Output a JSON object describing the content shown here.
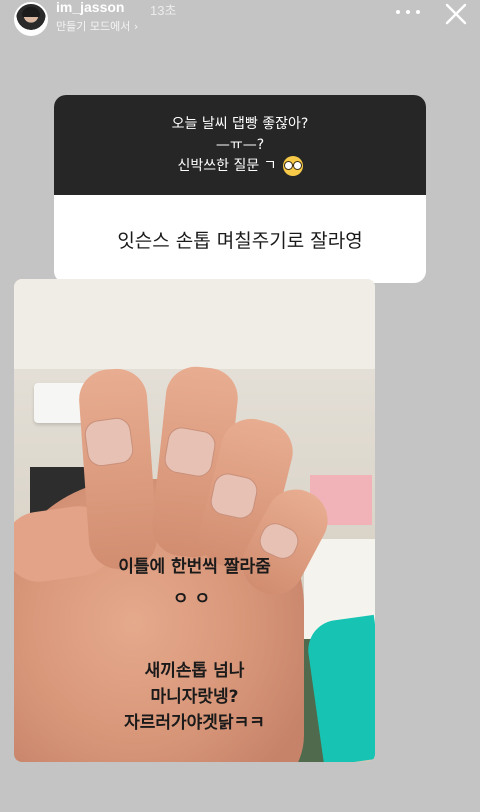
{
  "header": {
    "username": "im_jasson",
    "time": "13초",
    "subtitle": "만들기 모드에서",
    "subtitle_chevron": "›",
    "more_icon": "more-horizontal-icon",
    "close_icon": "close-icon"
  },
  "question": {
    "line1": "오늘 날씨 댑빵 좋잖아?",
    "line2": "—ㅠ—?",
    "line3": "신박쓰한 질문 ㄱ",
    "emoji": "nerd-face-emoji",
    "answer": "잇슨스 손톱 며칠주기로 잘라영"
  },
  "photo": {
    "caption_line1": "이틀에 한번씩 짤라줌",
    "caption_line2": "ㅇㅇ",
    "caption_line3": "새끼손톱 넘나",
    "caption_line4": "마니자랏넹?",
    "caption_line5": "자르러가야겟닭ㅋㅋ"
  },
  "colors": {
    "background": "#c4c4c4",
    "question_header_bg": "#262626",
    "answer_bg": "#ffffff",
    "sleeve": "#17c4b3"
  }
}
